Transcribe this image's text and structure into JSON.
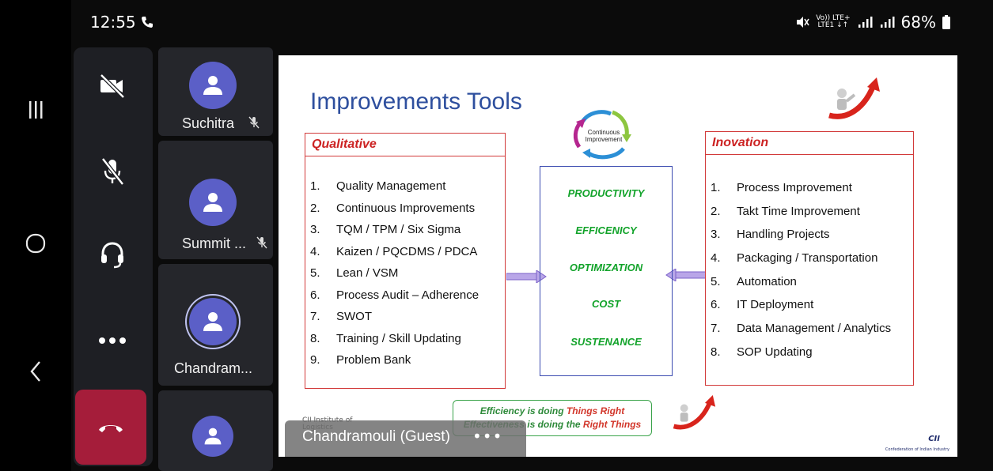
{
  "status_bar": {
    "time": "12:55",
    "network_top": "Vo)) LTE+",
    "network_bottom": "LTE1 ↓↑",
    "battery": "68%"
  },
  "participants": [
    {
      "name": "Suchitra",
      "muted": true
    },
    {
      "name": "Summit ...",
      "muted": true
    },
    {
      "name": "Chandram...",
      "muted": false,
      "speaking": true
    },
    {
      "name": "",
      "muted": false
    }
  ],
  "slide": {
    "title": "Improvements Tools",
    "cycle_label": "Continuous Improvement",
    "qualitative": {
      "heading": "Qualitative",
      "items": [
        {
          "num": "1.",
          "text": "Quality Management"
        },
        {
          "num": "2.",
          "text": "Continuous Improvements"
        },
        {
          "num": "3.",
          "text": "TQM / TPM / Six Sigma"
        },
        {
          "num": "4.",
          "text": "Kaizen / PQCDMS / PDCA"
        },
        {
          "num": "5.",
          "text": "Lean / VSM"
        },
        {
          "num": "6.",
          "text": "Process Audit – Adherence"
        },
        {
          "num": "7.",
          "text": "SWOT"
        },
        {
          "num": "8.",
          "text": "Training / Skill Updating"
        },
        {
          "num": "9.",
          "text": "Problem Bank"
        }
      ]
    },
    "center": [
      "PRODUCTIVITY",
      "EFFICENICY",
      "OPTIMIZATION",
      "COST",
      "SUSTENANCE"
    ],
    "inovation": {
      "heading": "Inovation",
      "items": [
        {
          "num": "1.",
          "text": "Process Improvement"
        },
        {
          "num": "2.",
          "text": "Takt Time Improvement"
        },
        {
          "num": "3.",
          "text": "Handling Projects"
        },
        {
          "num": "4.",
          "text": "Packaging / Transportation"
        },
        {
          "num": "5.",
          "text": "Automation"
        },
        {
          "num": "6.",
          "text": "IT Deployment"
        },
        {
          "num": "7.",
          "text": "Data Management / Analytics"
        },
        {
          "num": "8.",
          "text": "SOP Updating"
        }
      ]
    },
    "footer": {
      "line1_a": "Efficiency is doing ",
      "line1_b": "Things Right",
      "line2_a": "Effectiveness is doing the ",
      "line2_b": "Right Things"
    },
    "cii_institute": "CII Institute of Logistics",
    "cii_logo": "CII",
    "cii_sub": "Confederation of Indian Industry"
  },
  "presenter": {
    "name": "Chandramouli (Guest)",
    "more": "•••"
  },
  "colors": {
    "accent": "#5b5fc7",
    "hangup": "#a51d3a",
    "title_blue": "#2e4f9e",
    "box_red": "#d23a3a",
    "center_green": "#12a32a"
  }
}
